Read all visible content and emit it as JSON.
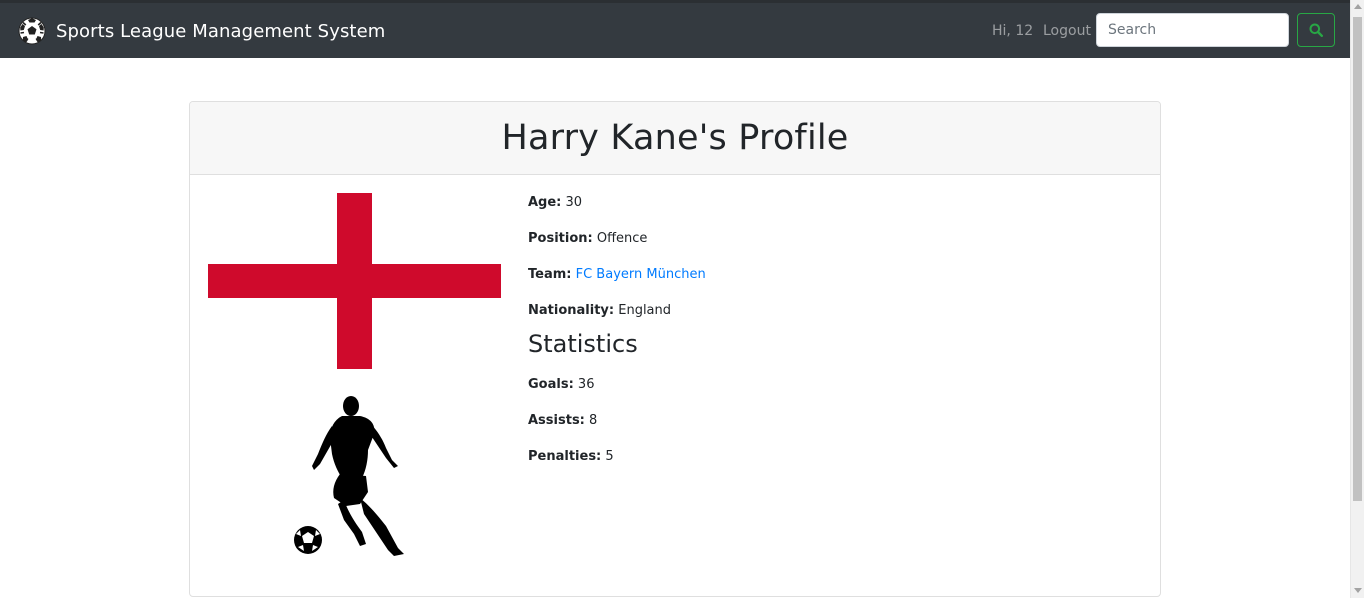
{
  "navbar": {
    "brand_text": "Sports League Management System",
    "brand_icon": "soccer-ball-icon",
    "greeting": "Hi, 12",
    "logout_label": "Logout",
    "search_placeholder": "Search",
    "search_value": "",
    "search_button_icon": "search-icon",
    "search_button_color": "#28a745"
  },
  "profile": {
    "title": "Harry Kane's Profile",
    "flag_icon": "england-flag",
    "flag_colors": {
      "field": "#ffffff",
      "cross": "#cf0a2c"
    },
    "player_image_icon": "soccer-player-silhouette",
    "fields": {
      "age_label": "Age:",
      "age": "30",
      "position_label": "Position:",
      "position": "Offence",
      "team_label": "Team:",
      "team": "FC Bayern München",
      "nationality_label": "Nationality:",
      "nationality": "England"
    },
    "statistics": {
      "heading": "Statistics",
      "goals_label": "Goals:",
      "goals": "36",
      "assists_label": "Assists:",
      "assists": "8",
      "penalties_label": "Penalties:",
      "penalties": "5"
    }
  },
  "colors": {
    "navbar_bg": "#343a40",
    "link": "#007bff",
    "card_header_bg": "#f7f7f7"
  }
}
